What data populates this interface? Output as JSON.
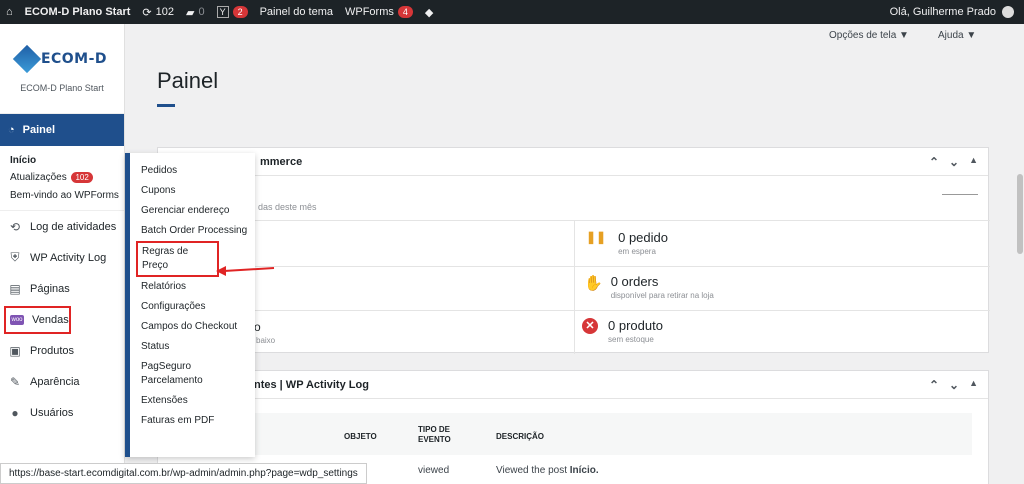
{
  "adminbar": {
    "site": "ECOM-D Plano Start",
    "updates_count": "102",
    "comments_count": "0",
    "yoast_badge": "2",
    "theme_panel": "Painel do tema",
    "wpforms": "WPForms",
    "wpforms_badge": "4",
    "greeting": "Olá, Guilherme Prado"
  },
  "sidebar": {
    "logo_text": "ECOM-D",
    "plan": "ECOM-D Plano Start",
    "painel": "Painel",
    "sub": {
      "inicio": "Início",
      "atualizacoes": "Atualizações",
      "atualizacoes_badge": "102",
      "bemvindo": "Bem-vindo ao WPForms"
    },
    "items": [
      {
        "label": "Log de atividades",
        "icon": "history-icon",
        "glyph": "⟲"
      },
      {
        "label": "WP Activity Log",
        "icon": "shield-icon",
        "glyph": "⛨"
      },
      {
        "label": "Páginas",
        "icon": "pages-icon",
        "glyph": "▤"
      },
      {
        "label": "Vendas",
        "icon": "woo-icon",
        "glyph": "▬"
      },
      {
        "label": "Produtos",
        "icon": "products-icon",
        "glyph": "▣"
      },
      {
        "label": "Aparência",
        "icon": "brush-icon",
        "glyph": "✎"
      },
      {
        "label": "Usuários",
        "icon": "user-icon",
        "glyph": "●"
      }
    ]
  },
  "flyout": [
    "Pedidos",
    "Cupons",
    "Gerenciar endereço",
    "Batch Order Processing",
    "Regras de Preço",
    "Relatórios",
    "Configurações",
    "Campos do Checkout",
    "Status",
    "PagSeguro Parcelamento",
    "Extensões",
    "Faturas em PDF"
  ],
  "top": {
    "screen_options": "Opções de tela ▼",
    "help": "Ajuda ▼"
  },
  "main": {
    "title": "Painel",
    "woo_panel_title": "mmerce",
    "woo_month_fragment": "das deste mês",
    "stat_pending_num": "0 pedido",
    "stat_pending_sub": "em espera",
    "stat_orders_num": "0 orders",
    "stat_orders_sub": "disponível para retirar na loja",
    "stat_stock_num": "0 produto",
    "stat_stock_sub": "sem estoque",
    "left_frag_1": "o",
    "left_frag_2": "baixo",
    "log_panel_title": "ntes | WP Activity Log",
    "col_objeto": "OBJETO",
    "col_tipo": "TIPO DE EVENTO",
    "col_descricao": "DESCRIÇÃO",
    "row_tipo": "viewed",
    "row_desc": "Viewed the post",
    "row_desc_bold": "Início."
  },
  "statusbar": {
    "url": "https://base-start.ecomdigital.com.br/wp-admin/admin.php?page=wdp_settings"
  },
  "colors": {
    "accent": "#1f4f8c",
    "highlight": "#e02424",
    "adminbar": "#1d2327"
  }
}
